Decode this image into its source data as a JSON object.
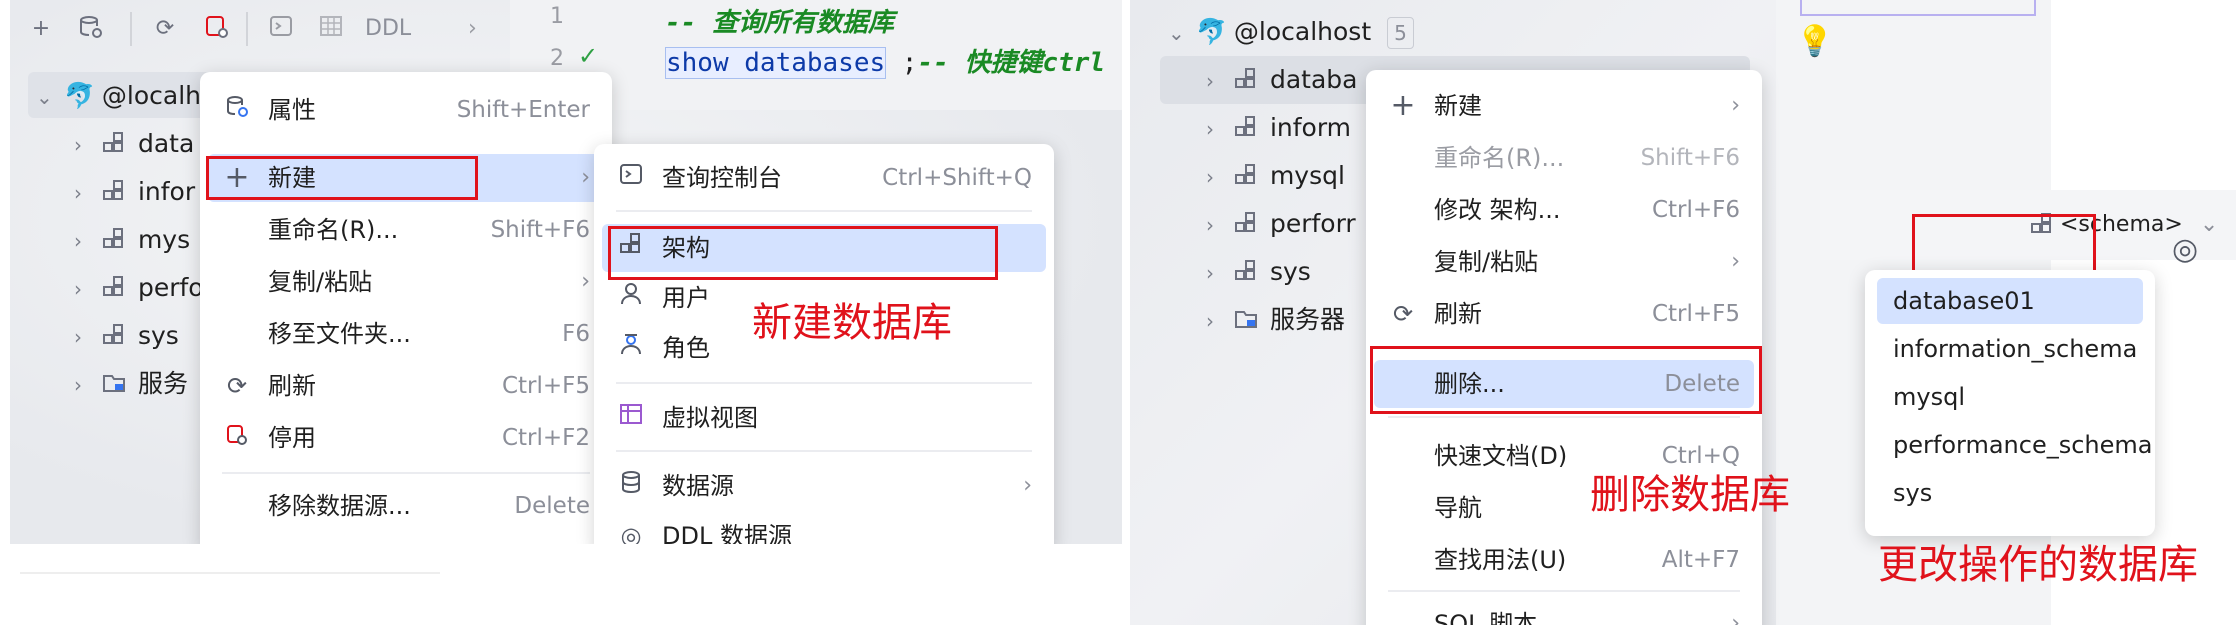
{
  "left": {
    "toolbar": {
      "ddl": "DDL"
    },
    "gutter": [
      "1",
      "2"
    ],
    "code": {
      "line1_comment": "-- 查询所有数据库",
      "line2_kw": "show databases",
      "line2_rest": " ;",
      "line2_comment": "-- 快捷键ctrl"
    },
    "tree": [
      {
        "label": "@localh"
      },
      {
        "label": "data"
      },
      {
        "label": "infor"
      },
      {
        "label": "mys"
      },
      {
        "label": "perfo"
      },
      {
        "label": "sys"
      },
      {
        "label": "服务"
      }
    ],
    "context_menu": {
      "items": [
        {
          "label": "属性",
          "shortcut": "Shift+Enter"
        },
        {
          "label": "新建",
          "arrow": "›"
        },
        {
          "label": "重命名(R)...",
          "shortcut": "Shift+F6"
        },
        {
          "label": "复制/粘贴",
          "arrow": "›"
        },
        {
          "label": "移至文件夹...",
          "shortcut": "F6"
        },
        {
          "label": "刷新",
          "shortcut": "Ctrl+F5"
        },
        {
          "label": "停用",
          "shortcut": "Ctrl+F2"
        },
        {
          "label": "移除数据源...",
          "shortcut": "Delete"
        }
      ]
    },
    "submenu": {
      "items": [
        {
          "label": "查询控制台",
          "shortcut": "Ctrl+Shift+Q"
        },
        {
          "label": "架构"
        },
        {
          "label": "用户"
        },
        {
          "label": "角色"
        },
        {
          "label": "虚拟视图"
        },
        {
          "label": "数据源",
          "arrow": "›"
        },
        {
          "label": "DDL 数据源"
        }
      ]
    },
    "annotation": "新建数据库"
  },
  "right": {
    "tree": [
      {
        "label": "@localhost",
        "badge": "5"
      },
      {
        "label": "databa"
      },
      {
        "label": "inform"
      },
      {
        "label": "mysql"
      },
      {
        "label": "perforr"
      },
      {
        "label": "sys"
      },
      {
        "label": "服务器"
      }
    ],
    "context_menu": {
      "items": [
        {
          "label": "新建",
          "arrow": "›"
        },
        {
          "label": "重命名(R)...",
          "shortcut": "Shift+F6"
        },
        {
          "label": "修改 架构...",
          "shortcut": "Ctrl+F6"
        },
        {
          "label": "复制/粘贴",
          "arrow": "›"
        },
        {
          "label": "刷新",
          "shortcut": "Ctrl+F5"
        },
        {
          "label": "删除...",
          "shortcut": "Delete"
        },
        {
          "label": "快速文档(D)",
          "shortcut": "Ctrl+Q"
        },
        {
          "label": "导航"
        },
        {
          "label": "查找用法(U)",
          "shortcut": "Alt+F7"
        },
        {
          "label": "SQL 脚本",
          "arrow": "›"
        }
      ]
    },
    "annotation_delete": "删除数据库",
    "schema_selector": {
      "label": "<schema>"
    },
    "schema_list": [
      "database01",
      "information_schema",
      "mysql",
      "performance_schema",
      "sys"
    ],
    "annotation_change": "更改操作的数据库"
  }
}
